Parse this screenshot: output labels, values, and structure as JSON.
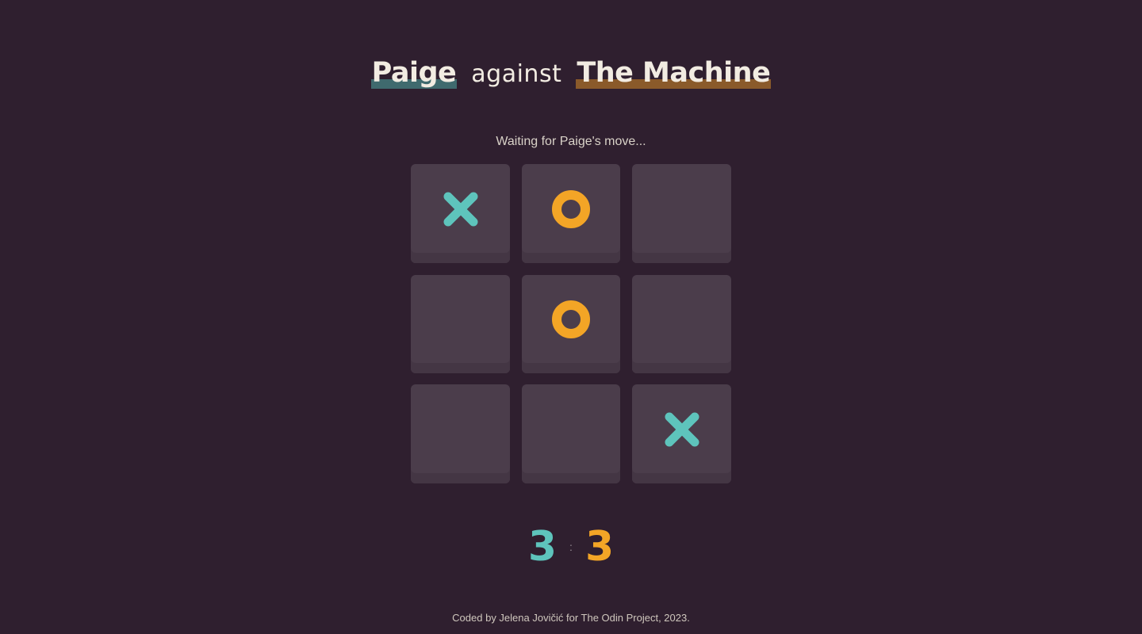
{
  "header": {
    "player1_name": "Paige",
    "versus_text": "against",
    "player2_name": "The Machine"
  },
  "status": {
    "message": "Waiting for Paige's move..."
  },
  "board": {
    "cells": [
      "X",
      "O",
      "",
      "",
      "O",
      "",
      "",
      "",
      "X"
    ]
  },
  "score": {
    "player1": "3",
    "separator": ":",
    "player2": "3"
  },
  "footer": {
    "credit": "Coded by Jelena Jovičić for The Odin Project, 2023."
  },
  "colors": {
    "background": "#2f1f2f",
    "cell": "#4b3d4b",
    "x_mark": "#5ec4bc",
    "o_mark": "#f3a526",
    "player1_underline": "#3f6a6e",
    "player2_underline": "#8a5a2a"
  }
}
